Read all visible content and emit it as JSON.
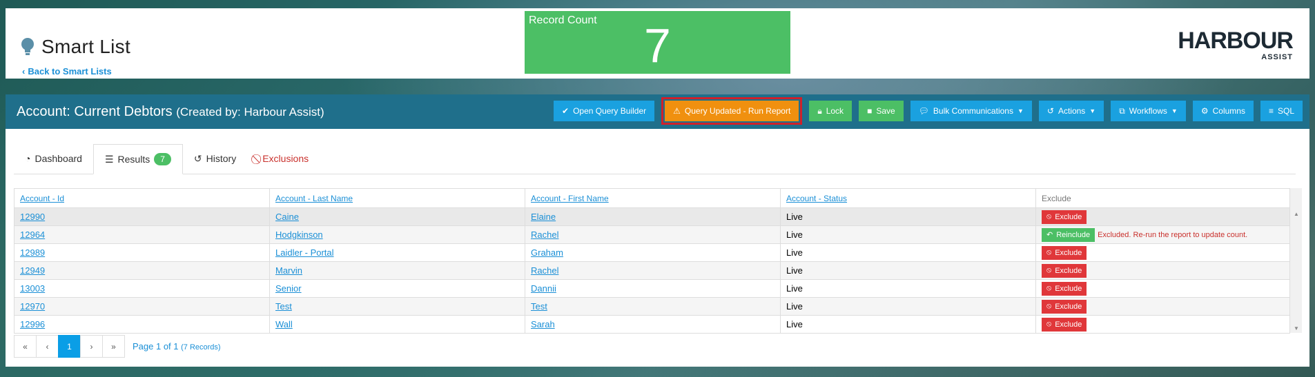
{
  "header": {
    "title": "Smart List",
    "back_link": "Back to Smart Lists",
    "record_count_label": "Record Count",
    "record_count_value": "7",
    "logo_main": "HARBOUR",
    "logo_sub": "ASSIST"
  },
  "report": {
    "title": "Account: Current Debtors",
    "created_by": "(Created by: Harbour Assist)",
    "toolbar": {
      "open_query": "Open Query Builder",
      "query_updated": "Query Updated - Run Report",
      "lock": "Lock",
      "save": "Save",
      "bulk": "Bulk Communications",
      "actions": "Actions",
      "workflows": "Workflows",
      "columns": "Columns",
      "sql": "SQL"
    }
  },
  "tabs": {
    "dashboard": "Dashboard",
    "results": "Results",
    "results_count": "7",
    "history": "History",
    "exclusions": "Exclusions"
  },
  "table": {
    "headers": [
      "Account - Id",
      "Account - Last Name",
      "Account - First Name",
      "Account - Status",
      "Exclude"
    ],
    "exclude_label": "Exclude",
    "reinclude_label": "Reinclude",
    "excluded_message": "Excluded. Re-run the report to update count.",
    "rows": [
      {
        "id": "12990",
        "last": "Caine",
        "first": "Elaine",
        "status": "Live"
      },
      {
        "id": "12964",
        "last": "Hodgkinson",
        "first": "Rachel",
        "status": "Live"
      },
      {
        "id": "12989",
        "last": "Laidler - Portal",
        "first": "Graham",
        "status": "Live"
      },
      {
        "id": "12949",
        "last": "Marvin",
        "first": "Rachel",
        "status": "Live"
      },
      {
        "id": "13003",
        "last": "Senior",
        "first": "Dannii",
        "status": "Live"
      },
      {
        "id": "12970",
        "last": "Test",
        "first": "Test",
        "status": "Live"
      },
      {
        "id": "12996",
        "last": "Wall",
        "first": "Sarah",
        "status": "Live"
      }
    ]
  },
  "pager": {
    "first": "«",
    "prev": "‹",
    "page": "1",
    "next": "›",
    "last": "»",
    "info": "Page 1 of 1",
    "records": "(7 Records)"
  },
  "colors": {
    "accent": "#1aa1e0",
    "bar": "#1f6f8b",
    "success": "#4cbf65",
    "warning": "#f0900f",
    "danger": "#e0373a"
  }
}
